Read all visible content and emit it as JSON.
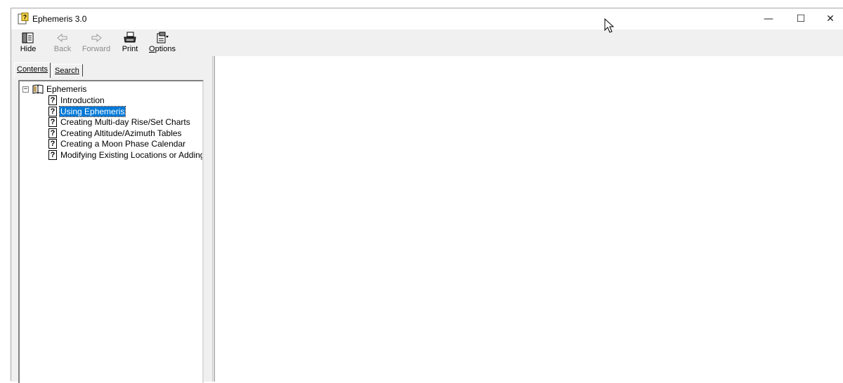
{
  "window": {
    "title": "Ephemeris 3.0",
    "icon": "help-file-icon",
    "controls": {
      "minimize": "—",
      "maximize": "☐",
      "close": "✕"
    }
  },
  "toolbar": {
    "hide_label": "Hide",
    "back_label": "Back",
    "forward_label": "Forward",
    "print_label": "Print",
    "options_label": "Options"
  },
  "nav": {
    "tabs": [
      {
        "label": "Contents",
        "selected": true
      },
      {
        "label": "Search",
        "selected": false
      }
    ],
    "tree": {
      "root_label": "Ephemeris",
      "items": [
        {
          "label": "Introduction",
          "selected": false
        },
        {
          "label": "Using Ephemeris",
          "selected": true
        },
        {
          "label": "Creating Multi-day Rise/Set Charts",
          "selected": false
        },
        {
          "label": "Creating Altitude/Azimuth Tables",
          "selected": false
        },
        {
          "label": "Creating a Moon Phase Calendar",
          "selected": false
        },
        {
          "label": "Modifying Existing Locations or Adding",
          "selected": false
        }
      ]
    }
  },
  "colors": {
    "selection": "#0078d7",
    "toolbar_bg": "#f0f0f0",
    "disabled_text": "#8c8c8c"
  }
}
